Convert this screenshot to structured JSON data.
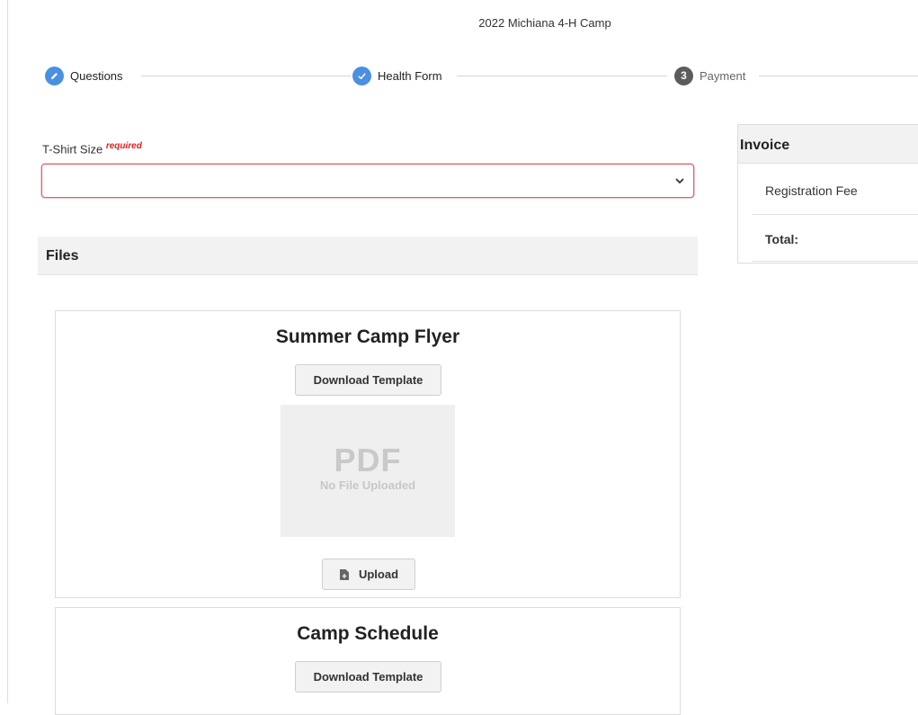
{
  "header": {
    "title": "2022 Michiana 4-H Camp"
  },
  "stepper": {
    "steps": [
      {
        "label": "Questions",
        "state": "done",
        "icon": "pencil-icon"
      },
      {
        "label": "Health Form",
        "state": "done",
        "icon": "check-icon"
      },
      {
        "label": "Payment",
        "state": "current",
        "number": "3"
      }
    ]
  },
  "form": {
    "tshirt": {
      "label": "T-Shirt Size",
      "required": "required",
      "value": ""
    }
  },
  "files": {
    "heading": "Files",
    "items": [
      {
        "title": "Summer Camp Flyer",
        "download_label": "Download Template",
        "preview_type": "PDF",
        "preview_status": "No File Uploaded",
        "upload_label": "Upload"
      },
      {
        "title": "Camp Schedule",
        "download_label": "Download Template"
      }
    ]
  },
  "invoice": {
    "heading": "Invoice",
    "line_item": "Registration Fee",
    "total_label": "Total:"
  },
  "colors": {
    "step_done": "#4a90e2",
    "step_pending": "#5c5c5c",
    "required": "#e02020",
    "invalid_border": "#e0606a"
  }
}
